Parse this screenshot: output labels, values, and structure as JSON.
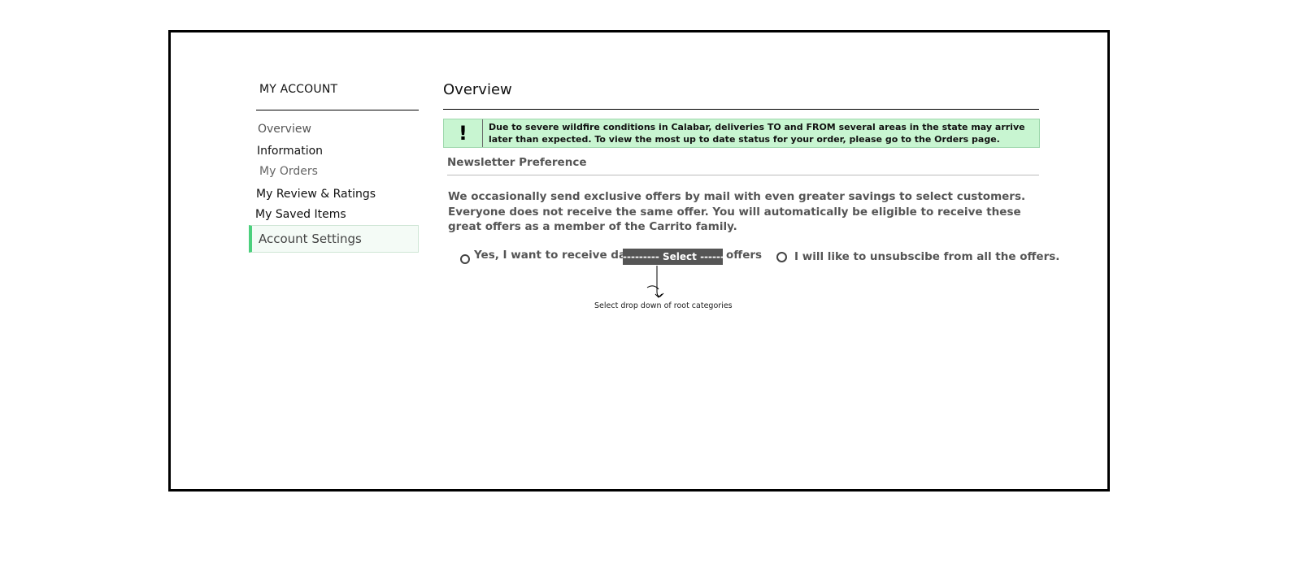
{
  "sidebar": {
    "title": "MY ACCOUNT",
    "items": [
      {
        "label": "Overview"
      },
      {
        "label": "Information"
      },
      {
        "label": "My Orders"
      },
      {
        "label": "My Review & Ratings"
      },
      {
        "label": "My Saved Items"
      },
      {
        "label": "Account Settings",
        "active": true
      }
    ],
    "active_color": "#4cd07d"
  },
  "main": {
    "title": "Overview",
    "alert": {
      "icon": "!",
      "text": "Due to severe wildfire conditions in Calabar, deliveries TO and FROM several areas in the state may arrive later than expected. To view the most up to date status for your order, please go to the Orders page.",
      "background": "#c8f5d1"
    },
    "newsletter": {
      "title": "Newsletter Preference",
      "description": "We occasionally send exclusive offers by mail with even greater savings to select customers. Everyone does not receive the same offer. You will automatically be eligible to receive these great offers as a member of the Carrito family.",
      "option_yes_prefix": "Yes, I want to receive daily",
      "select_label": "--------- Select --------",
      "option_yes_suffix": "offers",
      "option_unsubscribe": "I will like to unsubscibe from all the offers."
    },
    "annotation": "Select drop down of root categories"
  }
}
